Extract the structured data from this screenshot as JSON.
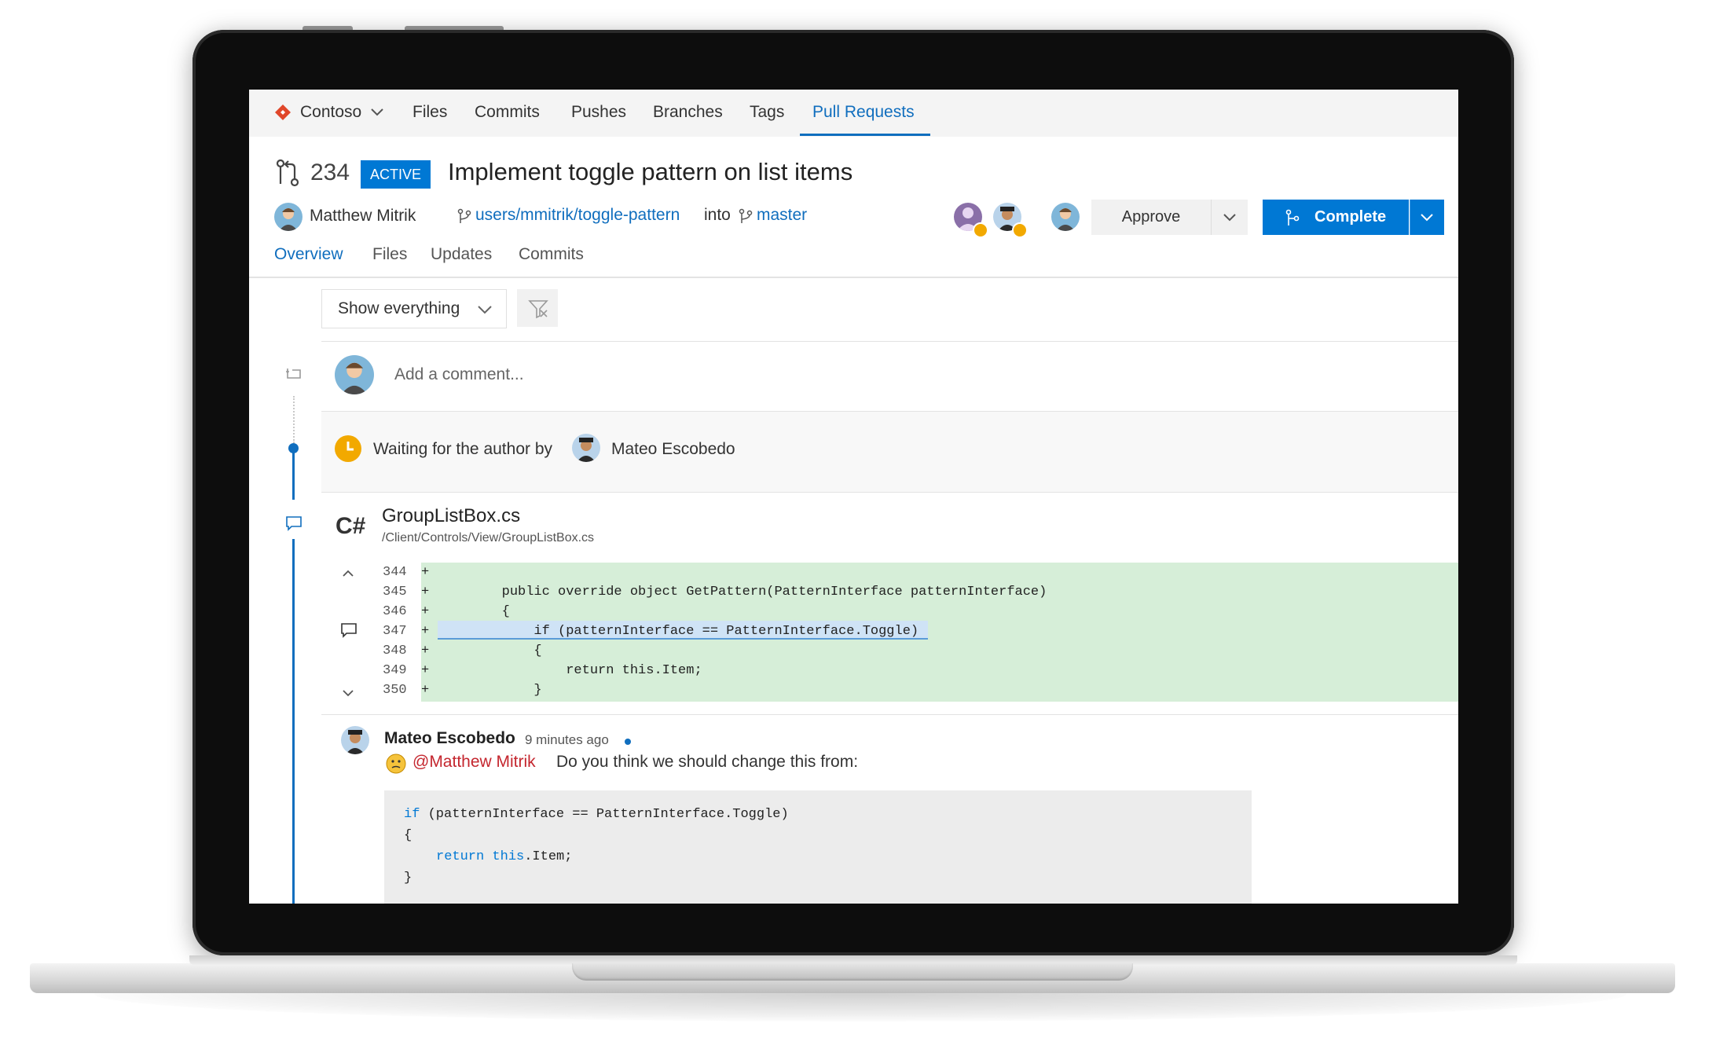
{
  "topnav": {
    "repo": "Contoso",
    "items": [
      "Files",
      "Commits",
      "Pushes",
      "Branches",
      "Tags",
      "Pull Requests"
    ],
    "active": "Pull Requests"
  },
  "pr": {
    "number": "234",
    "status": "ACTIVE",
    "title": "Implement toggle pattern on list items",
    "author": "Matthew Mitrik",
    "source_branch": "users/mmitrik/toggle-pattern",
    "into_label": "into",
    "target_branch": "master",
    "tabs": [
      "Overview",
      "Files",
      "Updates",
      "Commits"
    ],
    "active_tab": "Overview"
  },
  "actions": {
    "approve_label": "Approve",
    "complete_label": "Complete"
  },
  "filter": {
    "selected": "Show everything"
  },
  "comment_box": {
    "placeholder": "Add a comment..."
  },
  "status_event": {
    "text": "Waiting for the author by",
    "user": "Mateo Escobedo"
  },
  "file": {
    "language_icon": "C#",
    "name": "GroupListBox.cs",
    "path": "/Client/Controls/View/GroupListBox.cs",
    "lines": [
      {
        "num": "344",
        "sign": "+",
        "code": ""
      },
      {
        "num": "345",
        "sign": "+",
        "code": "        public override object GetPattern(PatternInterface patternInterface)"
      },
      {
        "num": "346",
        "sign": "+",
        "code": "        {"
      },
      {
        "num": "347",
        "sign": "+",
        "code": "            if (patternInterface == PatternInterface.Toggle)"
      },
      {
        "num": "348",
        "sign": "+",
        "code": "            {"
      },
      {
        "num": "349",
        "sign": "+",
        "code": "                return this.Item;"
      },
      {
        "num": "350",
        "sign": "+",
        "code": "            }"
      }
    ]
  },
  "thread": {
    "author": "Mateo Escobedo",
    "time": "9 minutes ago",
    "mention": "@Matthew Mitrik",
    "text": "Do you think we should change this from:",
    "code": {
      "line1_kw": "if",
      "line1_rest": " (patternInterface == PatternInterface.Toggle)",
      "line2": "{",
      "line3_kw1": "return",
      "line3_kw2": "this",
      "line3_rest": ".Item;",
      "line4": "}"
    }
  },
  "colors": {
    "accent": "#0078d4",
    "diff_added": "#d6eed8",
    "mention": "#c4262e",
    "waiting": "#f2a900",
    "repo_icon": "#e0472a"
  }
}
